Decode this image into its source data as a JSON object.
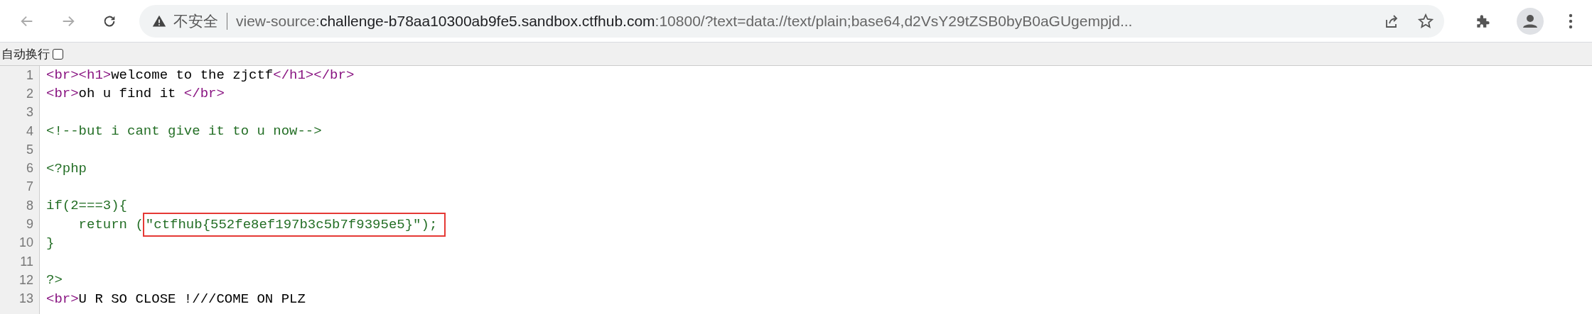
{
  "toolbar": {
    "back": {
      "disabled": true
    },
    "forward": {
      "disabled": true
    },
    "security_label": "不安全",
    "url": [
      {
        "kind": "dim",
        "text": "view-source:"
      },
      {
        "kind": "host",
        "text": "challenge-b78aa10300ab9fe5.sandbox.ctfhub.com"
      },
      {
        "kind": "dim",
        "text": ":10800/?text=data://text/plain;base64,d2VsY29tZSB0byB0aGUgempjd..."
      }
    ]
  },
  "wrap_option": {
    "label": "自动换行",
    "checked": false
  },
  "source_lines": [
    {
      "number": "1",
      "segments": [
        {
          "kind": "tag",
          "text": "<br><h1>"
        },
        {
          "kind": "text",
          "text": "welcome to the zjctf"
        },
        {
          "kind": "tag",
          "text": "</h1></br>"
        }
      ]
    },
    {
      "number": "2",
      "segments": [
        {
          "kind": "tag",
          "text": "<br>"
        },
        {
          "kind": "text",
          "text": "oh u find it "
        },
        {
          "kind": "tag",
          "text": "</br>"
        }
      ]
    },
    {
      "number": "3"
    },
    {
      "number": "4",
      "segments": [
        {
          "kind": "comment",
          "text": "<!--but i cant give it to u now-->"
        }
      ]
    },
    {
      "number": "5"
    },
    {
      "number": "6",
      "segments": [
        {
          "kind": "comment",
          "text": "<?php"
        }
      ]
    },
    {
      "number": "7"
    },
    {
      "number": "8",
      "segments": [
        {
          "kind": "comment",
          "text": "if(2===3){"
        }
      ]
    },
    {
      "number": "9",
      "segments": [
        {
          "kind": "comment",
          "text": "    return ("
        },
        {
          "kind": "highlight",
          "text": "\"ctfhub{552fe8ef197b3c5b7f9395e5}\");"
        }
      ]
    },
    {
      "number": "10",
      "segments": [
        {
          "kind": "comment",
          "text": "}"
        }
      ]
    },
    {
      "number": "11"
    },
    {
      "number": "12",
      "segments": [
        {
          "kind": "comment",
          "text": "?>"
        }
      ]
    },
    {
      "number": "13",
      "segments": [
        {
          "kind": "tag",
          "text": "<br>"
        },
        {
          "kind": "text",
          "text": "U R SO CLOSE !///COME ON PLZ"
        }
      ]
    }
  ]
}
